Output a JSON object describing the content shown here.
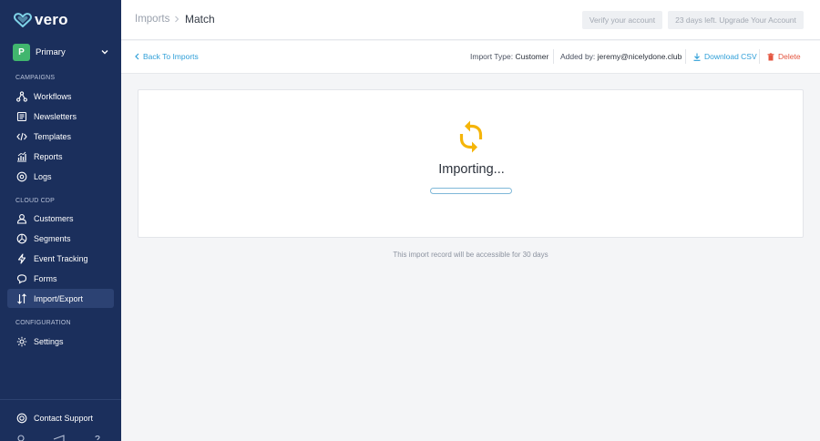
{
  "brand": {
    "name": "vero"
  },
  "workspace": {
    "initial": "P",
    "name": "Primary"
  },
  "sidebar": {
    "sections": [
      {
        "label": "CAMPAIGNS"
      },
      {
        "label": "CLOUD CDP"
      },
      {
        "label": "CONFIGURATION"
      }
    ],
    "items": [
      {
        "label": "Workflows",
        "icon": "workflow-icon"
      },
      {
        "label": "Newsletters",
        "icon": "newsletter-icon"
      },
      {
        "label": "Templates",
        "icon": "code-icon"
      },
      {
        "label": "Reports",
        "icon": "chart-icon"
      },
      {
        "label": "Logs",
        "icon": "logs-icon"
      },
      {
        "label": "Customers",
        "icon": "user-icon"
      },
      {
        "label": "Segments",
        "icon": "pie-icon"
      },
      {
        "label": "Event Tracking",
        "icon": "bolt-icon"
      },
      {
        "label": "Forms",
        "icon": "chat-icon"
      },
      {
        "label": "Import/Export",
        "icon": "import-export-icon",
        "active": true
      },
      {
        "label": "Settings",
        "icon": "gear-icon"
      }
    ],
    "support_label": "Contact Support"
  },
  "topbar": {
    "breadcrumb_root": "Imports",
    "breadcrumb_current": "Match",
    "verify_label": "Verify your account",
    "upgrade_label": "23 days left. Upgrade Your Account"
  },
  "subbar": {
    "back_label": "Back To Imports",
    "import_type_label": "Import Type:",
    "import_type_value": "Customer",
    "added_by_label": "Added by:",
    "added_by_value": "jeremy@nicelydone.club",
    "download_label": "Download CSV",
    "delete_label": "Delete"
  },
  "main": {
    "status": "Importing...",
    "progress_percent": 0,
    "note": "This import record will be accessible for 30 days"
  },
  "colors": {
    "sidebar_bg": "#1b2f5c",
    "link": "#2f9fd8",
    "danger": "#e4553f",
    "spinner": "#f5b50a",
    "workspace_badge": "#41b66e"
  }
}
